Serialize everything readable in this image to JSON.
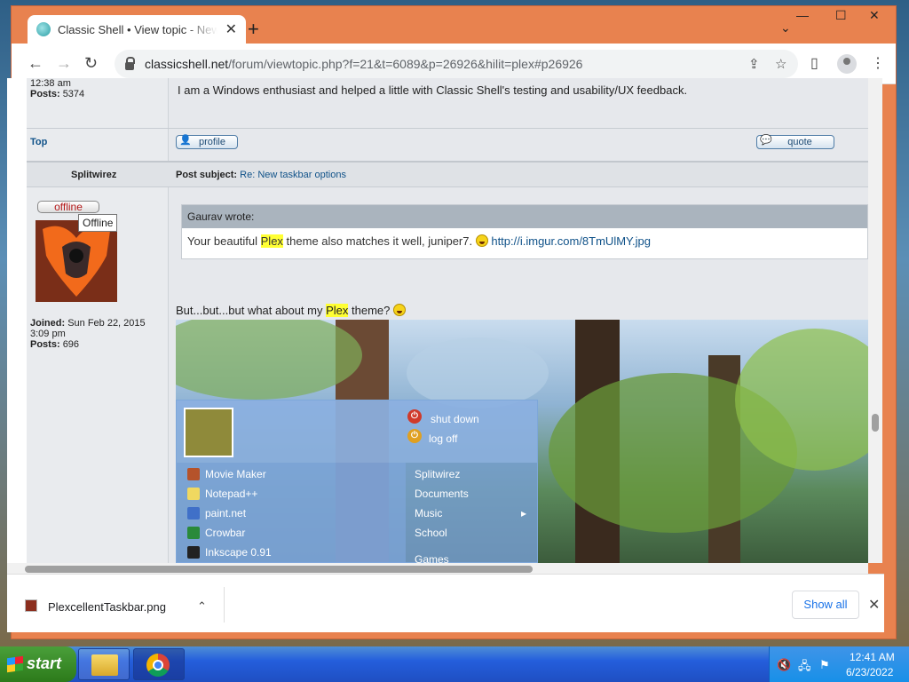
{
  "browser": {
    "tab_title": "Classic Shell • View topic - New taskbar options",
    "tab_close": "✕",
    "new_tab": "+",
    "tab_search": "⌄",
    "minimize": "—",
    "maximize": "☐",
    "close": "✕",
    "url_host": "classicshell.net",
    "url_path": "/forum/viewtopic.php?f=21&t=6089&p=26926&hilit=plex#p26926"
  },
  "icons": {
    "back": "arrow-left-icon",
    "forward": "arrow-right-icon",
    "reload": "reload-icon",
    "share": "share-icon",
    "bookmark": "star-icon",
    "sidepanel": "side-panel-icon",
    "menu": "kebab-menu-icon"
  },
  "glyphs": {
    "back": "←",
    "forward": "→",
    "reload": "↻",
    "share": "⇪",
    "bookmark": "☆",
    "sidepanel": "▯",
    "menu": "⋮",
    "profile": "👤",
    "quote": "💬"
  },
  "prev_post": {
    "time": "12:38 am",
    "posts_label": "Posts:",
    "posts_value": "5374",
    "text": "I am a Windows enthusiast and helped a little with Classic Shell's testing and usability/UX feedback.",
    "top_link": "Top",
    "profile_btn": "profile",
    "quote_btn": "quote"
  },
  "post": {
    "author": "Splitwirez",
    "subject_label": "Post subject:",
    "subject": "Re: New taskbar options",
    "status_btn": "offline",
    "tooltip": "Offline",
    "joined_label": "Joined:",
    "joined_value": "Sun Feb 22, 2015",
    "joined_time": "3:09 pm",
    "posts_label": "Posts:",
    "posts_value": "696",
    "quote_author": "Gaurav wrote:",
    "quote_pre": "Your beautiful ",
    "quote_hl": "Plex",
    "quote_post": " theme also matches it well, juniper7. ",
    "quote_link": "http://i.imgur.com/8TmUlMY.jpg",
    "reply_pre": "But...but...but what about my ",
    "reply_hl": "Plex",
    "reply_post": " theme? "
  },
  "startmenu": {
    "shutdown": "shut down",
    "logoff": "log off",
    "left_items": [
      "Movie Maker",
      "Notepad++",
      "paint.net",
      "Crowbar",
      "Inkscape 0.91"
    ],
    "right_items": [
      "Splitwirez",
      "Documents",
      "Music",
      "School",
      "Games"
    ],
    "submenu_arrow": "▸"
  },
  "downloads": {
    "file": "PlexcellentTaskbar.png",
    "chevron": "⌃",
    "show_all": "Show all",
    "close": "✕"
  },
  "taskbar": {
    "start": "start",
    "time": "12:41 AM",
    "date": "6/23/2022",
    "tray_glyphs": [
      "🔇",
      "🖧",
      "⚑"
    ]
  },
  "colors": {
    "window_frame": "#e8824f",
    "link": "#105289",
    "highlight": "#ffff33",
    "offline_red": "#b41919"
  }
}
